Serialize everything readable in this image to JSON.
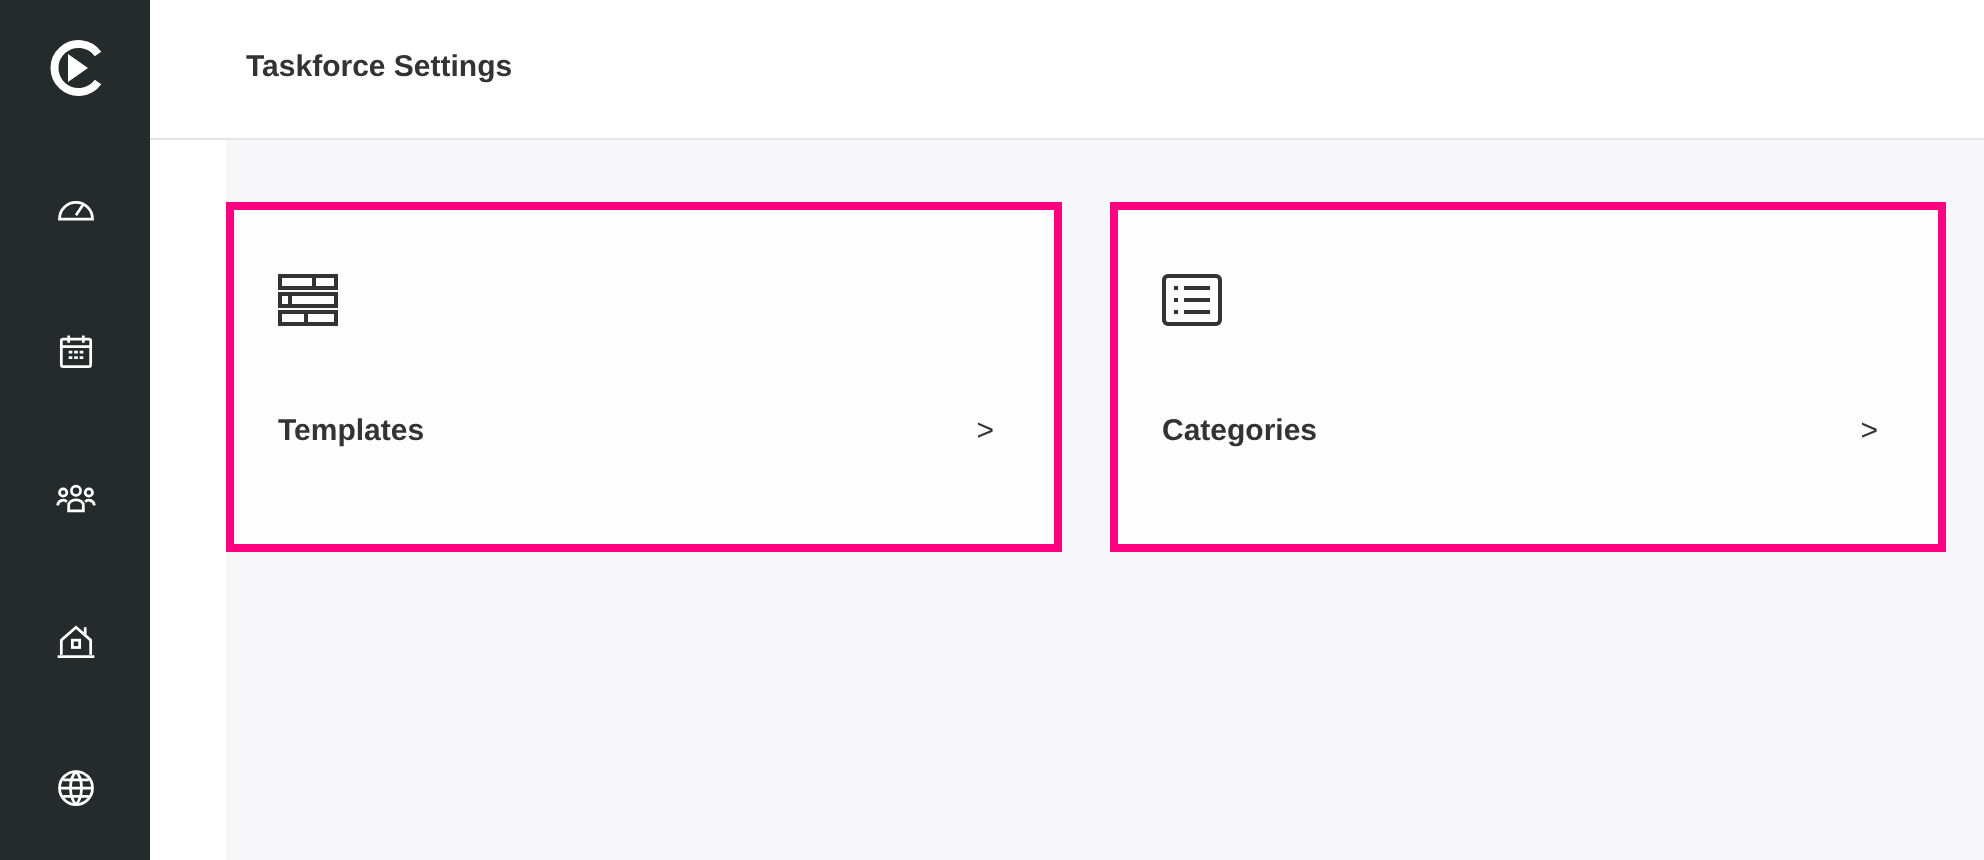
{
  "header": {
    "title": "Taskforce Settings"
  },
  "sidebar": {
    "items": [
      {
        "kind": "gauge"
      },
      {
        "kind": "calendar"
      },
      {
        "kind": "people"
      },
      {
        "kind": "house"
      },
      {
        "kind": "globe"
      }
    ]
  },
  "cards": [
    {
      "kind": "templates",
      "label": "Templates",
      "chevron": ">"
    },
    {
      "kind": "categories",
      "label": "Categories",
      "chevron": ">"
    }
  ]
}
